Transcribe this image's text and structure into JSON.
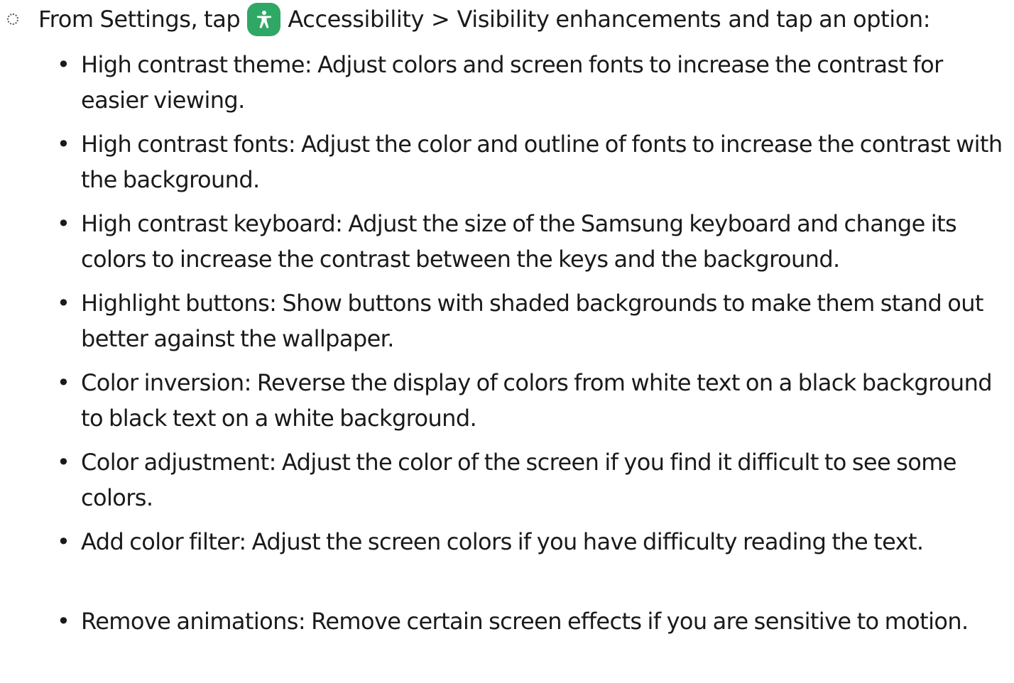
{
  "intro": {
    "prefix": "From Settings, tap",
    "menu_accessibility": "Accessibility",
    "separator": ">",
    "menu_visibility": "Visibility enhancements",
    "suffix": "and tap an option:",
    "icon": "accessibility-icon",
    "icon_color": "#2fa866"
  },
  "options": [
    {
      "term": "High contrast theme",
      "description": ": Adjust colors and screen fonts to increase the contrast for easier viewing."
    },
    {
      "term": "High contrast fonts",
      "description": ": Adjust the color and outline of fonts to increase the contrast with the background."
    },
    {
      "term": "High contrast keyboard",
      "description": ": Adjust the size of the Samsung keyboard and change its colors to increase the contrast between the keys and the background."
    },
    {
      "term": "Highlight buttons",
      "description": ": Show buttons with shaded backgrounds to make them stand out better against the wallpaper."
    },
    {
      "term": "Color inversion",
      "description": ": Reverse the display of colors from white text on a black background to black text on a white background."
    },
    {
      "term": "Color adjustment",
      "description": ": Adjust the color of the screen if you find it difficult to see some colors."
    },
    {
      "term": "Add color filter",
      "description": ": Adjust the screen colors if you have difficulty reading the text."
    },
    {
      "term": "Remove animations",
      "description": ": Remove certain screen effects if you are sensitive to motion."
    }
  ]
}
